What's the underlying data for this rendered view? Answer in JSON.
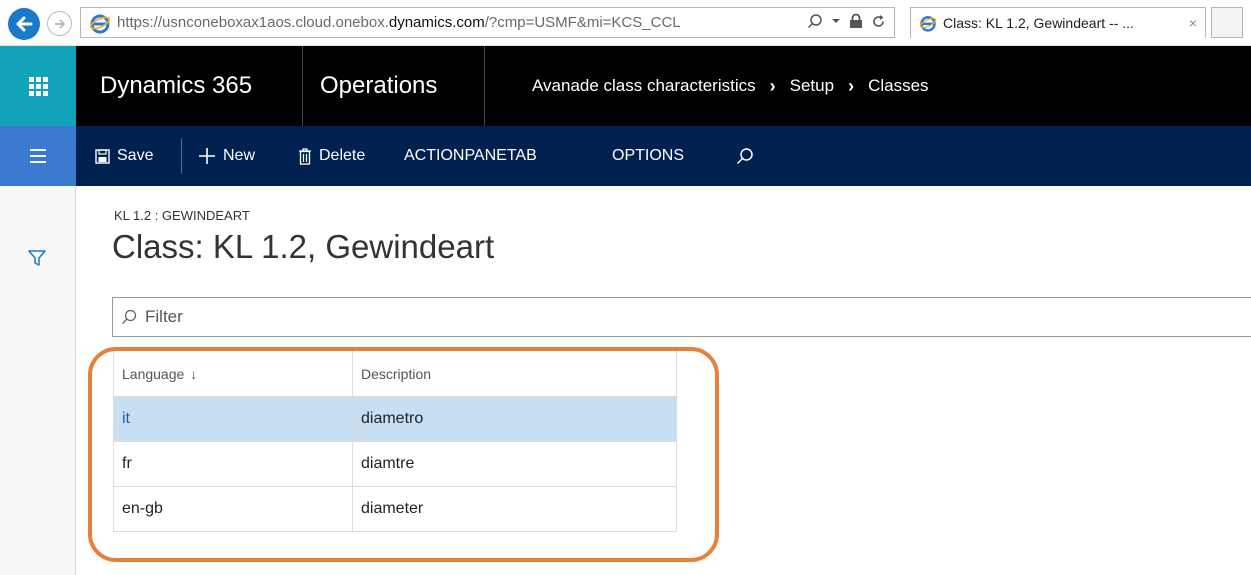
{
  "browser": {
    "url_prefix": "https://usnconeboxax1aos.cloud.onebox.",
    "url_domain": "dynamics.com",
    "url_suffix": "/?cmp=USMF&mi=KCS_CCL",
    "tab_title": "Class: KL 1.2, Gewindeart -- ...",
    "tab_close": "×"
  },
  "navbar": {
    "brand": "Dynamics 365",
    "module": "Operations",
    "breadcrumb": [
      "Avanade class characteristics",
      "Setup",
      "Classes"
    ],
    "separator": "›"
  },
  "actionpane": {
    "save": "Save",
    "new": "New",
    "delete": "Delete",
    "actionpanetab": "ACTIONPANETAB",
    "options": "OPTIONS"
  },
  "page": {
    "caption": "KL 1.2 : GEWINDEART",
    "title": "Class: KL 1.2, Gewindeart",
    "filter_placeholder": "Filter"
  },
  "grid": {
    "columns": [
      "Language",
      "Description"
    ],
    "sort_indicator": "↓",
    "rows": [
      {
        "language": "it",
        "description": "diametro",
        "selected": true
      },
      {
        "language": "fr",
        "description": "diamtre",
        "selected": false
      },
      {
        "language": "en-gb",
        "description": "diameter",
        "selected": false
      }
    ]
  },
  "colors": {
    "waffle": "#11a3b8",
    "actionpane": "#002050",
    "hamburger": "#3a7ad0",
    "selected_row": "#c6dff3",
    "highlight": "#e8803a"
  }
}
